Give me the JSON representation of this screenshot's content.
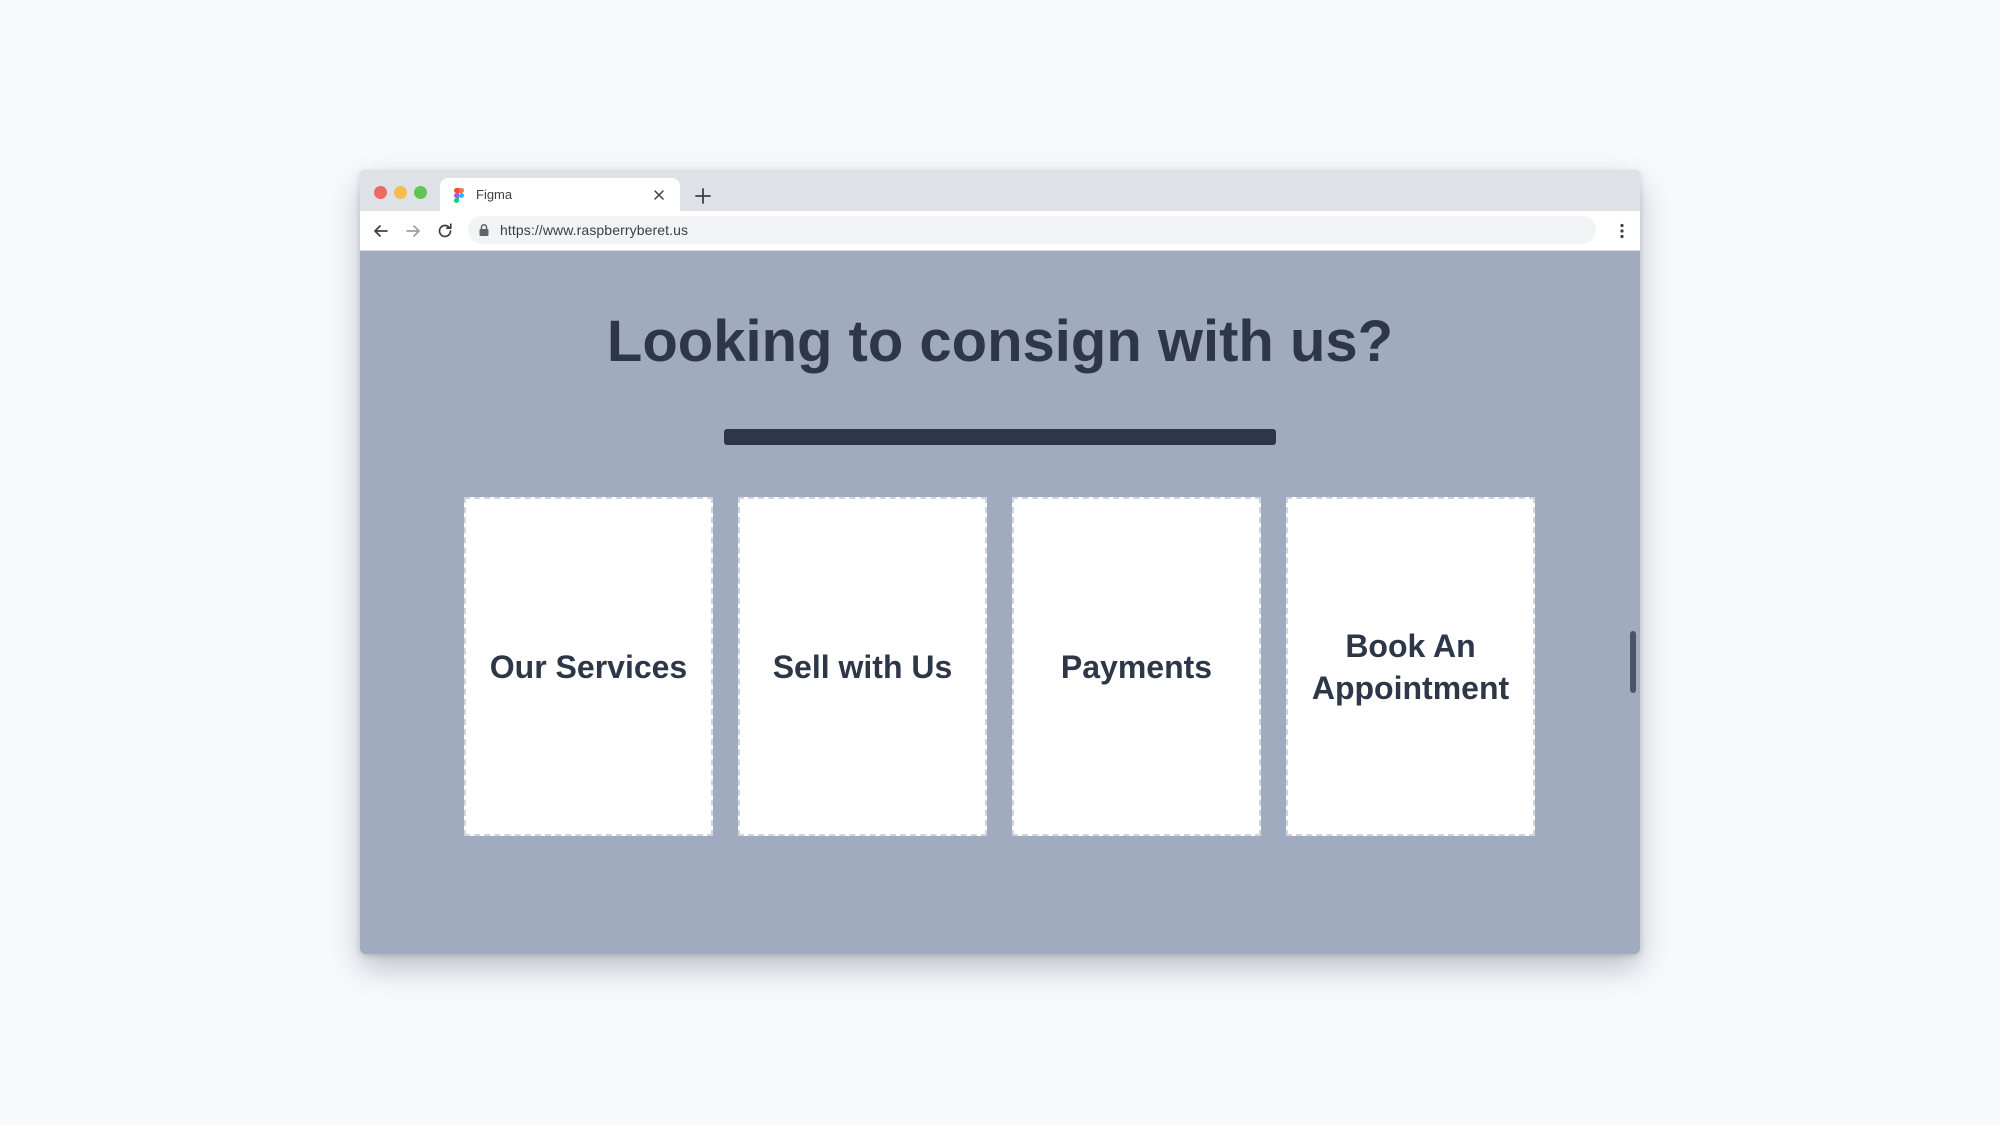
{
  "browser": {
    "tab": {
      "title": "Figma",
      "favicon": "figma-logo-icon",
      "close_icon": "close-icon"
    },
    "new_tab_icon": "plus-icon",
    "nav": {
      "back_icon": "arrow-left-icon",
      "forward_icon": "arrow-right-icon",
      "reload_icon": "reload-icon",
      "menu_icon": "kebab-menu-icon"
    },
    "address_bar": {
      "lock_icon": "lock-icon",
      "url": "https://www.raspberryberet.us"
    },
    "traffic_lights": {
      "close_color": "#ee6a5f",
      "minimize_color": "#f5bd4f",
      "maximize_color": "#61c454"
    }
  },
  "page": {
    "headline": "Looking to consign with us?",
    "cards": [
      {
        "label": "Our Services"
      },
      {
        "label": "Sell with Us"
      },
      {
        "label": "Payments"
      },
      {
        "label": "Book An Appointment"
      }
    ],
    "colors": {
      "background": "#a0abc0",
      "text": "#2d3748",
      "card": "#ffffff",
      "page_backdrop": "#f7f9fc"
    }
  }
}
